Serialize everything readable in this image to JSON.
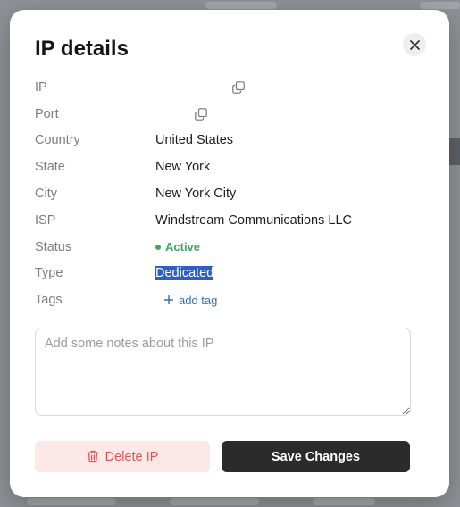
{
  "dialog": {
    "title": "IP details"
  },
  "details": {
    "ip": {
      "label": "IP",
      "value": ""
    },
    "port": {
      "label": "Port",
      "value": ""
    },
    "country": {
      "label": "Country",
      "value": "United States"
    },
    "state": {
      "label": "State",
      "value": "New York"
    },
    "city": {
      "label": "City",
      "value": "New York City"
    },
    "isp": {
      "label": "ISP",
      "value": "Windstream Communications LLC"
    },
    "status": {
      "label": "Status",
      "value": "Active",
      "color": "#3ea95c"
    },
    "type": {
      "label": "Type",
      "value": "Dedicated"
    },
    "tags": {
      "label": "Tags",
      "add_label": "add tag"
    }
  },
  "notes": {
    "placeholder": "Add some notes about this IP",
    "value": ""
  },
  "actions": {
    "delete_label": "Delete IP",
    "save_label": "Save Changes"
  },
  "colors": {
    "accent_dark": "#2b2b2b",
    "danger": "#e05454",
    "danger_bg": "#fde8e8",
    "link": "#2f6bb3",
    "selection": "#2e5fc4"
  },
  "icons": {
    "close": "close-icon",
    "copy": "copy-icon",
    "plus": "plus-icon",
    "trash": "trash-icon"
  }
}
